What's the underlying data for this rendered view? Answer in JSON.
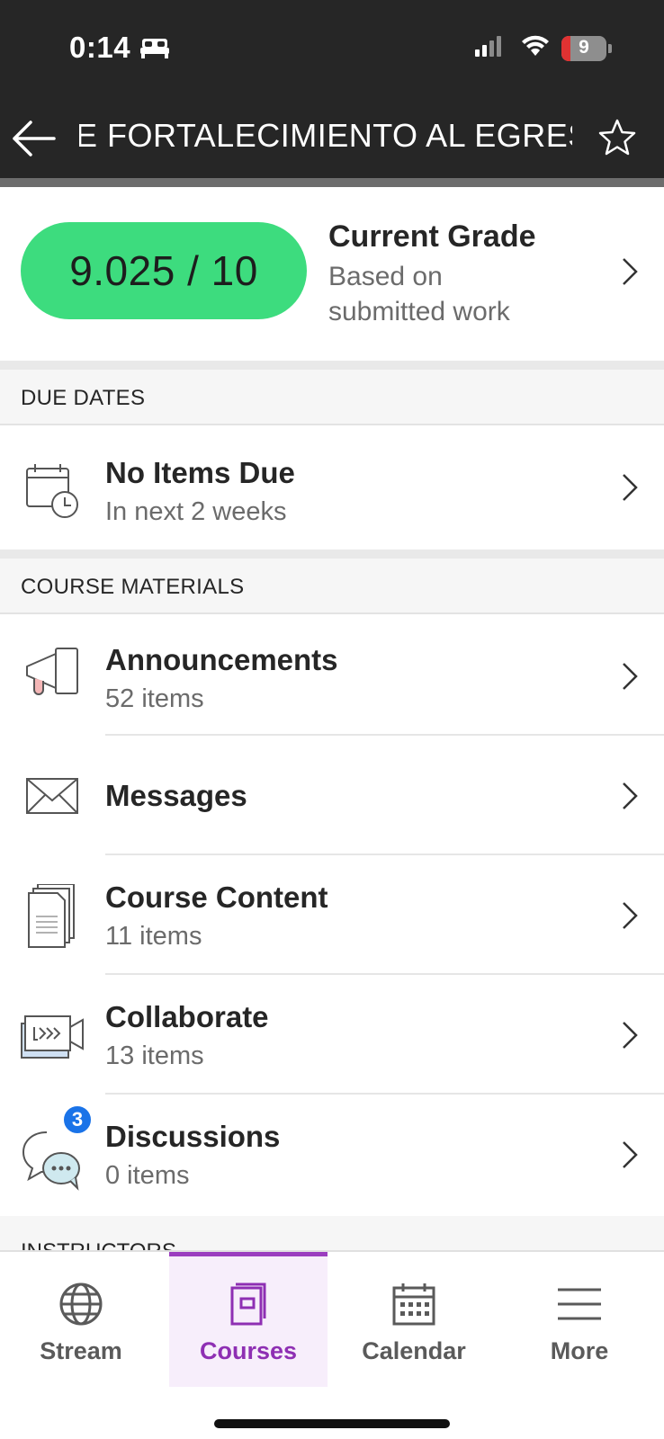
{
  "status_bar": {
    "time": "0:14",
    "battery": "9"
  },
  "nav": {
    "title": "E FORTALECIMIENTO AL EGRESO"
  },
  "grade": {
    "value": "9.025 / 10",
    "title": "Current Grade",
    "subtitle": "Based on submitted work"
  },
  "due_dates": {
    "header": "DUE DATES",
    "item": {
      "title": "No Items Due",
      "subtitle": "In next 2 weeks"
    }
  },
  "course_materials": {
    "header": "COURSE MATERIALS",
    "items": [
      {
        "title": "Announcements",
        "subtitle": "52 items",
        "icon": "megaphone-icon"
      },
      {
        "title": "Messages",
        "subtitle": "",
        "icon": "envelope-icon"
      },
      {
        "title": "Course Content",
        "subtitle": "11 items",
        "icon": "document-stack-icon"
      },
      {
        "title": "Collaborate",
        "subtitle": "13 items",
        "icon": "video-camera-icon"
      },
      {
        "title": "Discussions",
        "subtitle": "0 items",
        "icon": "chat-bubbles-icon",
        "badge": "3"
      }
    ]
  },
  "instructors": {
    "header": "INSTRUCTORS"
  },
  "tabbar": {
    "tabs": [
      {
        "label": "Stream",
        "icon": "globe-icon"
      },
      {
        "label": "Courses",
        "icon": "book-icon",
        "active": true
      },
      {
        "label": "Calendar",
        "icon": "calendar-icon"
      },
      {
        "label": "More",
        "icon": "menu-icon"
      }
    ]
  },
  "colors": {
    "grade_pill": "#3ddc7e",
    "active_tab": "#8e2fb3",
    "badge": "#1a73e8",
    "top_bar": "#262626"
  }
}
